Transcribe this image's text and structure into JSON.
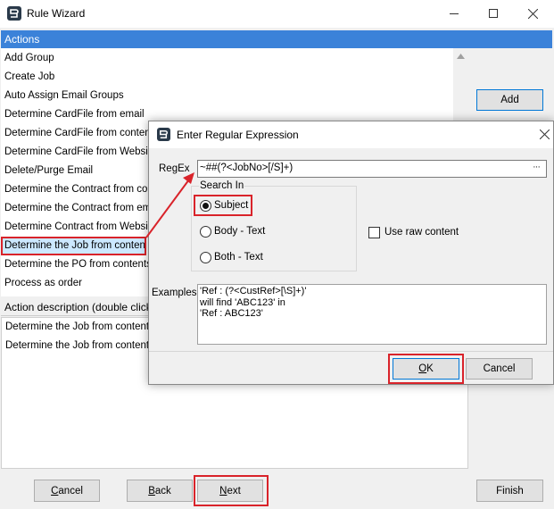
{
  "main_window": {
    "title": "Rule Wizard",
    "actions_header": "Actions",
    "actions": [
      "Add Group",
      "Create Job",
      "Auto Assign Email Groups",
      "Determine CardFile from email",
      "Determine CardFile from contents",
      "Determine CardFile from Website",
      "Delete/Purge Email",
      "Determine the Contract from conte",
      "Determine the Contract from emai",
      "Determine Contract from Website",
      "Determine the Job from contents",
      "Determine the PO from contents",
      "Process as order"
    ],
    "selected_action_index": 10,
    "description_header": "Action description (double click to",
    "description_items": [
      "Determine the Job from contents",
      "Determine the Job from contents"
    ],
    "add_button": "Add",
    "cancel_button": "Cancel",
    "back_button": "Back",
    "next_button": "Next",
    "finish_button": "Finish"
  },
  "dialog": {
    "title": "Enter Regular Expression",
    "regex_label": "RegEx",
    "regex_value": "~##(?<JobNo>[/S]+)",
    "ellipsis": "···",
    "search_in_label": "Search In",
    "options": [
      "Subject",
      "Body - Text",
      "Both - Text"
    ],
    "selected_option": 0,
    "raw_content_label": "Use raw content",
    "examples_label": "Examples",
    "examples_lines": [
      "'Ref : (?<CustRef>[\\S]+)'",
      "will find 'ABC123' in",
      "'Ref : ABC123'"
    ],
    "ok_button": "OK",
    "cancel_button": "Cancel"
  },
  "colors": {
    "accent": "#3b82d9",
    "highlight_red": "#d9232a",
    "selection": "#cce8ff"
  }
}
